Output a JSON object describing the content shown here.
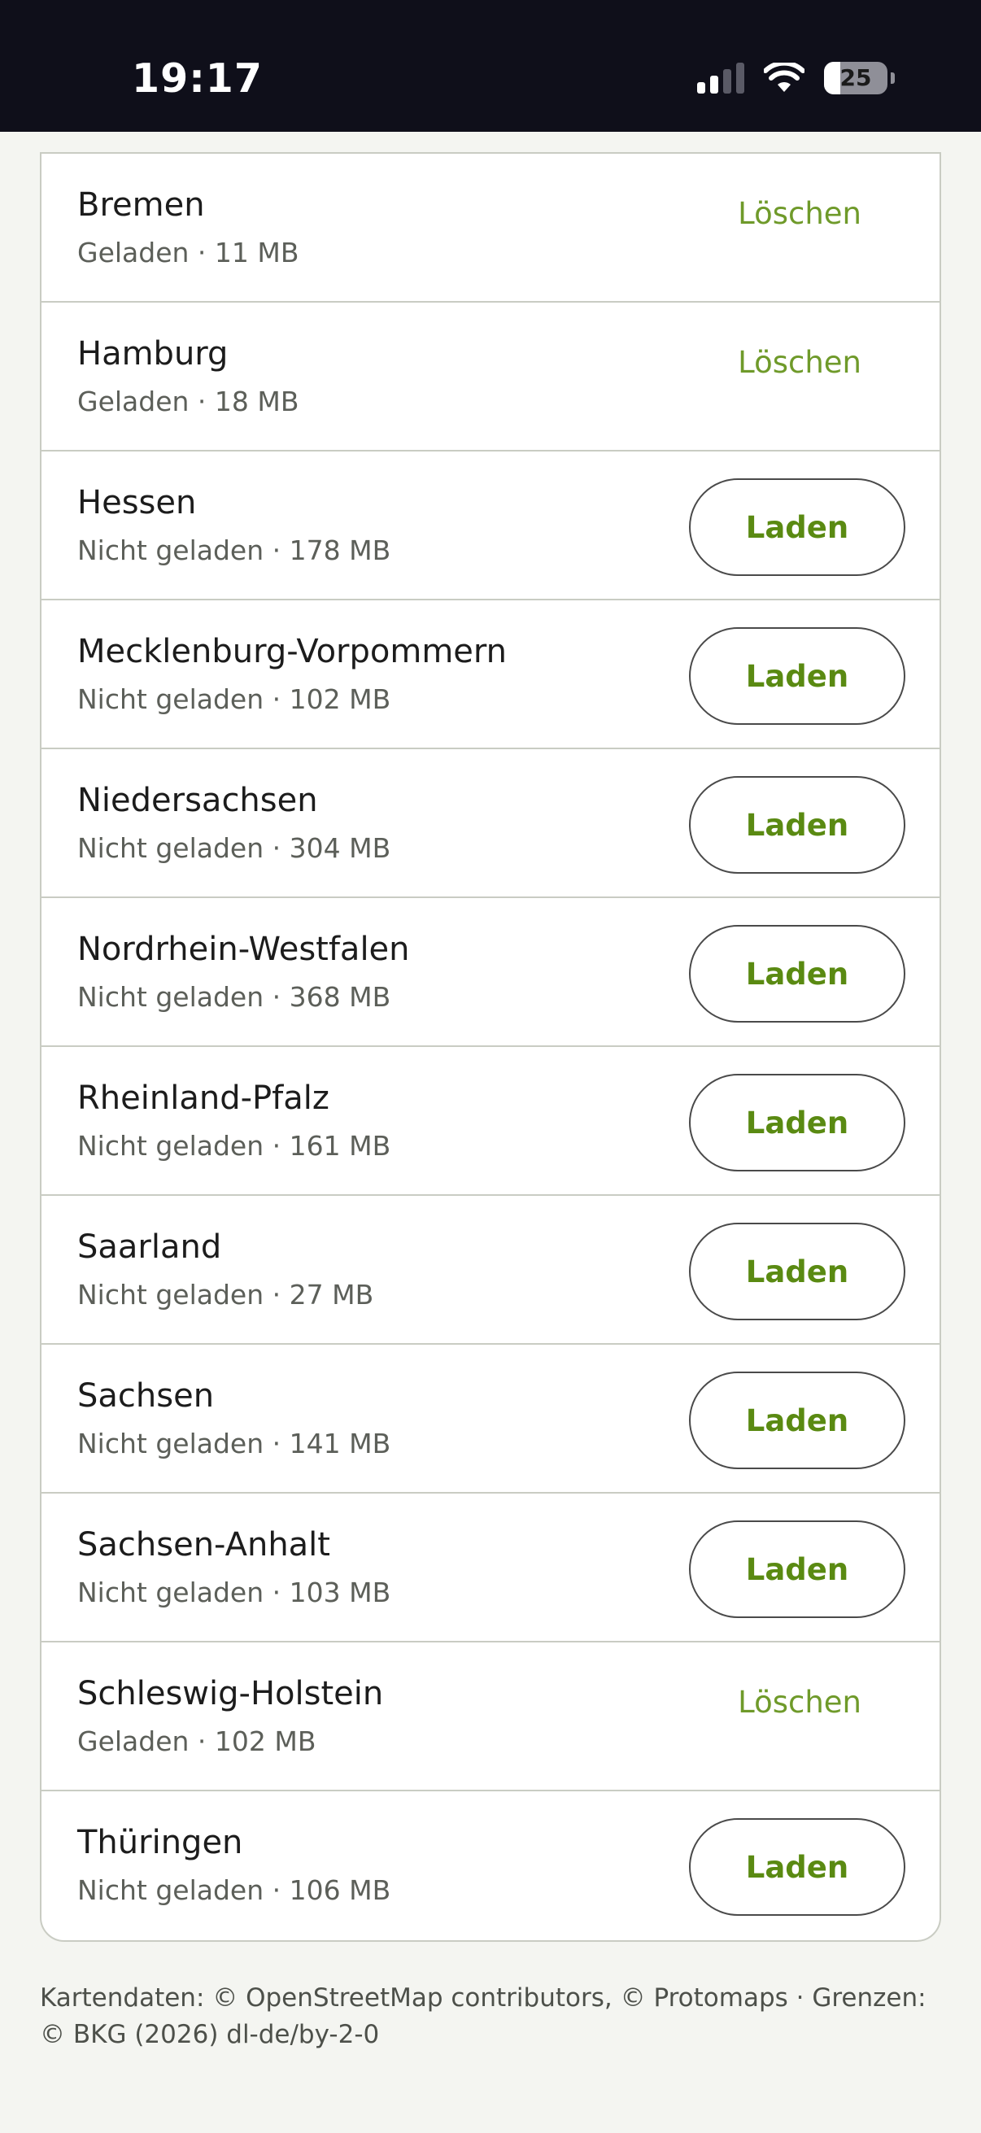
{
  "status_bar": {
    "time": "19:17",
    "battery_level": "25",
    "battery_fraction": 0.25,
    "signal_bars_active": 2,
    "signal_bars_total": 4
  },
  "regions": [
    {
      "name": "Bremen",
      "meta": "Geladen · 11 MB",
      "action": "delete",
      "action_label": "Löschen"
    },
    {
      "name": "Hamburg",
      "meta": "Geladen · 18 MB",
      "action": "delete",
      "action_label": "Löschen"
    },
    {
      "name": "Hessen",
      "meta": "Nicht geladen · 178 MB",
      "action": "load",
      "action_label": "Laden"
    },
    {
      "name": "Mecklenburg-Vorpommern",
      "meta": "Nicht geladen · 102 MB",
      "action": "load",
      "action_label": "Laden"
    },
    {
      "name": "Niedersachsen",
      "meta": "Nicht geladen · 304 MB",
      "action": "load",
      "action_label": "Laden"
    },
    {
      "name": "Nordrhein-Westfalen",
      "meta": "Nicht geladen · 368 MB",
      "action": "load",
      "action_label": "Laden"
    },
    {
      "name": "Rheinland-Pfalz",
      "meta": "Nicht geladen · 161 MB",
      "action": "load",
      "action_label": "Laden"
    },
    {
      "name": "Saarland",
      "meta": "Nicht geladen · 27 MB",
      "action": "load",
      "action_label": "Laden"
    },
    {
      "name": "Sachsen",
      "meta": "Nicht geladen · 141 MB",
      "action": "load",
      "action_label": "Laden"
    },
    {
      "name": "Sachsen-Anhalt",
      "meta": "Nicht geladen · 103 MB",
      "action": "load",
      "action_label": "Laden"
    },
    {
      "name": "Schleswig-Holstein",
      "meta": "Geladen · 102 MB",
      "action": "delete",
      "action_label": "Löschen"
    },
    {
      "name": "Thüringen",
      "meta": "Nicht geladen · 106 MB",
      "action": "load",
      "action_label": "Laden"
    }
  ],
  "footer": {
    "attribution": "Kartendaten: © OpenStreetMap contributors, © Protomaps · Grenzen: © BKG (2026) dl-de/by-2-0"
  },
  "colors": {
    "accent_green": "#5a8a12",
    "delete_green": "#6f9a2a",
    "status_bar_bg": "#0f0f1a",
    "page_bg": "#f4f5f1"
  },
  "icons": {
    "signal": "cellular-signal-icon",
    "wifi": "wifi-icon",
    "battery": "battery-icon"
  }
}
